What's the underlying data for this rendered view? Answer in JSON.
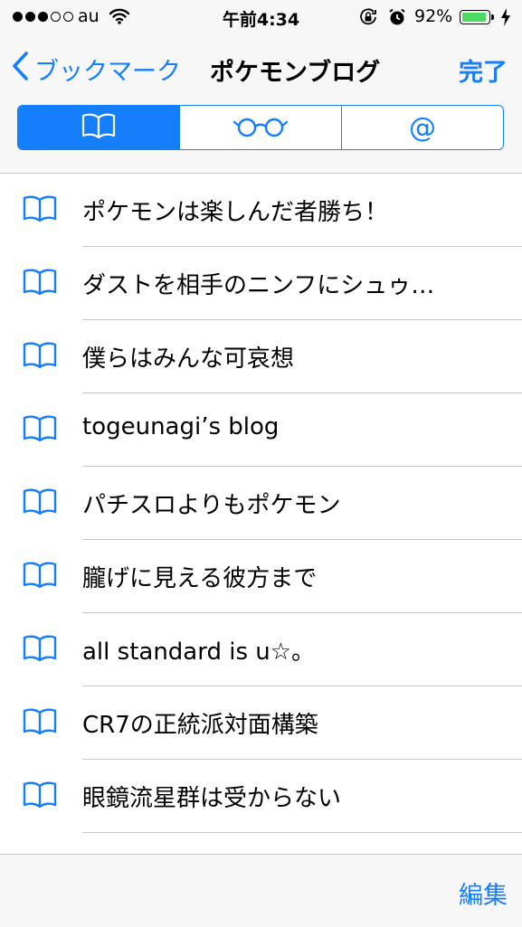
{
  "status_bar": {
    "carrier": "au",
    "time": "午前4:34",
    "battery_percent": "92%",
    "battery_level": 0.92,
    "signal_bars_filled": 3,
    "signal_bars_total": 5,
    "icons": [
      "wifi-icon",
      "orientation-lock-icon",
      "alarm-icon",
      "battery-icon",
      "charging-icon"
    ]
  },
  "nav": {
    "back_label": "ブックマーク",
    "title": "ポケモンブログ",
    "done_label": "完了"
  },
  "segments": {
    "items": [
      {
        "icon": "bookmarks-icon",
        "selected": true
      },
      {
        "icon": "reading-list-icon",
        "selected": false
      },
      {
        "icon": "shared-links-icon",
        "label": "@",
        "selected": false
      }
    ]
  },
  "bookmarks": [
    {
      "title": "ポケモンは楽しんだ者勝ち！"
    },
    {
      "title": "ダストを相手のニンフにシュゥ…"
    },
    {
      "title": "僕らはみんな可哀想"
    },
    {
      "title": "togeunagi’s blog"
    },
    {
      "title": "パチスロよりもポケモン"
    },
    {
      "title": "朧げに見える彼方まで"
    },
    {
      "title": "all standard is u☆。"
    },
    {
      "title": "CR7の正統派対面構築"
    },
    {
      "title": "眼鏡流星群は受からない"
    }
  ],
  "toolbar": {
    "edit_label": "編集"
  },
  "colors": {
    "accent": "#147efb",
    "bar_background": "#f7f7f7",
    "separator": "#c8c7cc",
    "battery": "#4cd964"
  }
}
